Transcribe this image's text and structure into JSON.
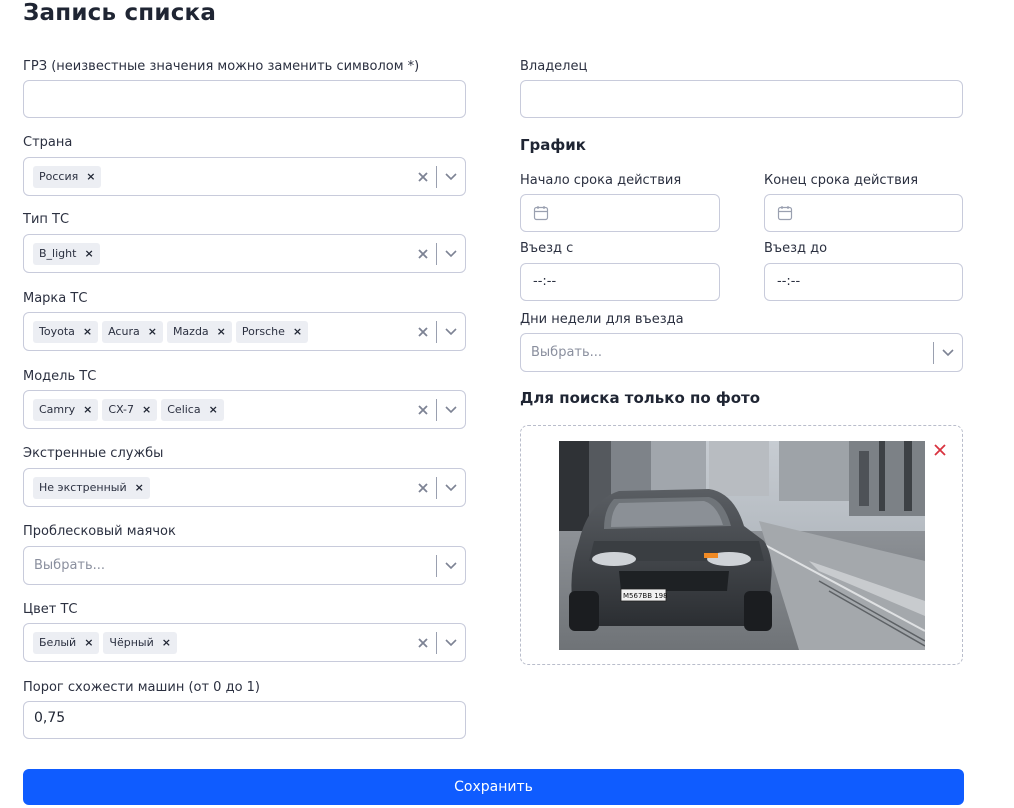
{
  "page": {
    "title": "Запись списка"
  },
  "left": {
    "grz": {
      "label": "ГРЗ (неизвестные значения можно заменить символом *)",
      "value": ""
    },
    "country": {
      "label": "Страна",
      "tags": [
        "Россия"
      ]
    },
    "vehicle_type": {
      "label": "Тип ТС",
      "tags": [
        "B_light"
      ]
    },
    "brand": {
      "label": "Марка ТС",
      "tags": [
        "Toyota",
        "Acura",
        "Mazda",
        "Porsche"
      ]
    },
    "model": {
      "label": "Модель ТС",
      "tags": [
        "Camry",
        "CX-7",
        "Celica"
      ]
    },
    "emergency": {
      "label": "Экстренные службы",
      "tags": [
        "Не экстренный"
      ]
    },
    "beacon": {
      "label": "Проблесковый маячок",
      "placeholder": "Выбрать..."
    },
    "color": {
      "label": "Цвет ТС",
      "tags": [
        "Белый",
        "Чёрный"
      ]
    },
    "threshold": {
      "label": "Порог схожести машин (от 0 до 1)",
      "value": "0,75"
    }
  },
  "right": {
    "owner": {
      "label": "Владелец",
      "value": ""
    },
    "schedule": {
      "heading": "График",
      "start_label": "Начало срока действия",
      "end_label": "Конец срока действия",
      "entry_from_label": "Въезд с",
      "entry_from_value": "--:--",
      "entry_to_label": "Въезд до",
      "entry_to_value": "--:--",
      "weekdays_label": "Дни недели для въезда",
      "weekdays_placeholder": "Выбрать..."
    },
    "photo": {
      "heading": "Для поиска только по фото",
      "plate_text": "M567BB 198"
    }
  },
  "actions": {
    "save_label": "Сохранить"
  },
  "colors": {
    "accent": "#0f5cff",
    "border": "#c8cbdb",
    "tag_bg": "#eceef3",
    "remove_red": "#d9333f"
  }
}
